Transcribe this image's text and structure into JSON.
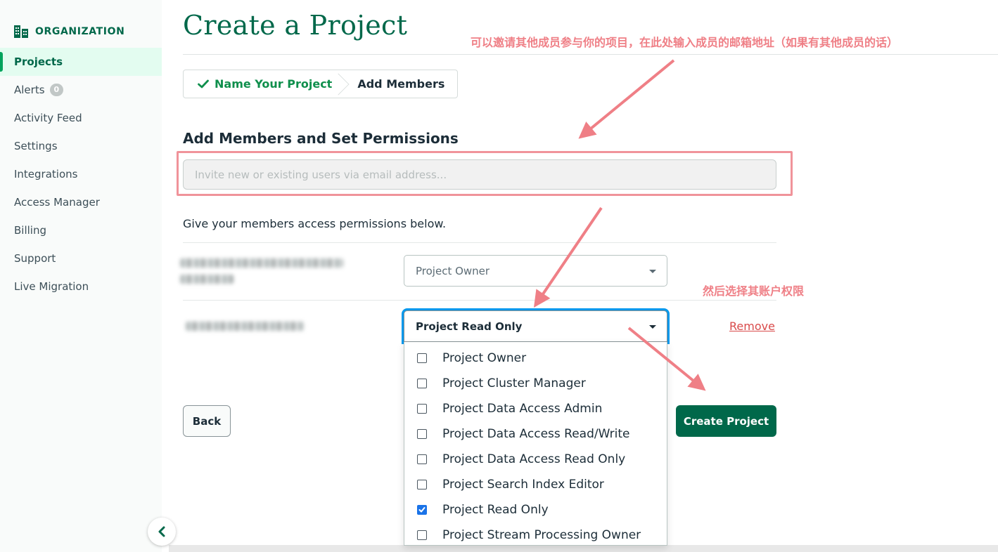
{
  "sidebar": {
    "org_label": "ORGANIZATION",
    "items": [
      {
        "label": "Projects",
        "active": true
      },
      {
        "label": "Alerts",
        "badge": "0"
      },
      {
        "label": "Activity Feed"
      },
      {
        "label": "Settings"
      },
      {
        "label": "Integrations"
      },
      {
        "label": "Access Manager"
      },
      {
        "label": "Billing"
      },
      {
        "label": "Support"
      },
      {
        "label": "Live Migration"
      }
    ]
  },
  "page": {
    "title": "Create a Project"
  },
  "steps": {
    "done_label": "Name Your Project",
    "current_label": "Add Members"
  },
  "members_section": {
    "title": "Add Members and Set Permissions",
    "email_placeholder": "Invite new or existing users via email address...",
    "permissions_description": "Give your members access permissions below."
  },
  "members": [
    {
      "role": "Project Owner"
    },
    {
      "role": "Project Read Only",
      "remove_label": "Remove"
    }
  ],
  "role_options": [
    {
      "label": "Project Owner",
      "checked": false
    },
    {
      "label": "Project Cluster Manager",
      "checked": false
    },
    {
      "label": "Project Data Access Admin",
      "checked": false
    },
    {
      "label": "Project Data Access Read/Write",
      "checked": false
    },
    {
      "label": "Project Data Access Read Only",
      "checked": false
    },
    {
      "label": "Project Search Index Editor",
      "checked": false
    },
    {
      "label": "Project Read Only",
      "checked": true
    },
    {
      "label": "Project Stream Processing Owner",
      "checked": false
    }
  ],
  "actions": {
    "back_label": "Back",
    "create_label": "Create Project"
  },
  "annotations": {
    "invite_note": "可以邀请其他成员参与你的项目，在此处输入成员的邮箱地址（如果有其他成员的话）",
    "permission_note": "然后选择其账户权限"
  },
  "colors": {
    "brand_green": "#00684a",
    "success_green": "#0f8f4c",
    "annotation_pink": "#ef7f86",
    "focus_blue": "#0498ec",
    "checkbox_blue": "#1a73e8",
    "remove_red": "#d94b4b"
  }
}
